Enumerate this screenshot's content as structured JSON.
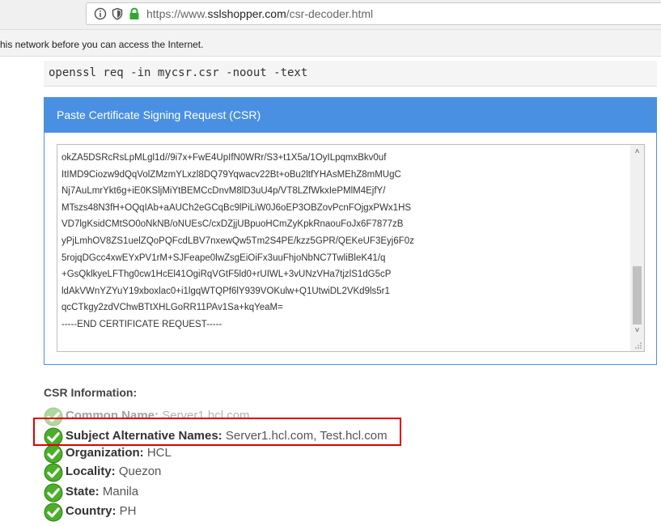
{
  "browser": {
    "url_prefix": "https://www.",
    "url_domain": "sslshopper.com",
    "url_path": "/csr-decoder.html",
    "icons": [
      "info-icon",
      "tracking-shield-icon",
      "lock-icon"
    ],
    "lock_color": "#2eaa2e"
  },
  "notice": {
    "text": "his network before you can access the Internet."
  },
  "command": {
    "text": "openssl req -in mycsr.csr -noout -text"
  },
  "panel": {
    "title": "Paste Certificate Signing Request (CSR)",
    "accent": "#4a90e2",
    "csr_lines": [
      "okZA5DSRcRsLpMLgl1d//9i7x+FwE4UpIfN0WRr/S3+t1X5a/1OyILpqmxBkv0uf",
      "ItIMD9Ciozw9dQqVolZMzmYLxzl8DQ79Yqwacv22Bt+oBu2ltfYHAsMEhZ8mMUgC",
      "Nj7AuLmrYkt6g+iE0KSljMiYtBEMCcDnvM8lD3uU4p/VT8LZfWkxIePMlM4EjfY/",
      "MTszs48N3fH+OQqIAb+aAUCh2eGCqBc9lPiLiW0J6oEP3OBZovPcnFOjgxPWx1HS",
      "VD7lgKsidCMtSO0oNkNB/oNUEsC/cxDZjjUBpuoHCmZyKpkRnaouFoJx6F7877zB",
      "yPjLmhOV8ZS1uelZQoPQFcdLBV7nxewQw5Tm2S4PE/kzz5GPR/QEKeUF3Eyj6F0z",
      "5rojqDGcc4xwEYxPV1rM+SJFeape0lwZsgEiOiFx3uuFhjoNbNC7TwliBleK41/q",
      "+GsQklkyeLFThg0cw1HcEl41OgiRqVGtF5ld0+rUIWL+3vUNzVHa7tjzlS1dG5cP",
      "ldAkVWnYZYuY19xboxlac0+i1lgqWTQPf6lY939VOKulw+Q1UtwiDL2VKd9ls5r1",
      "qcCTkgy2zdVChwBTtXHLGoRR11PAv1Sa+kqYeaM=",
      "-----END CERTIFICATE REQUEST-----"
    ]
  },
  "csr_info": {
    "heading": "CSR Information:",
    "check_color": "#4caf2a",
    "rows": [
      {
        "label": "Common Name:",
        "value": "Server1.hcl.com"
      },
      {
        "label": "Subject Alternative Names:",
        "value": "Server1.hcl.com, Test.hcl.com"
      },
      {
        "label": "Organization:",
        "value": "HCL"
      },
      {
        "label": "Locality:",
        "value": "Quezon"
      },
      {
        "label": "State:",
        "value": "Manila"
      },
      {
        "label": "Country:",
        "value": "PH"
      }
    ]
  },
  "annotation": {
    "color": "#e00000"
  }
}
